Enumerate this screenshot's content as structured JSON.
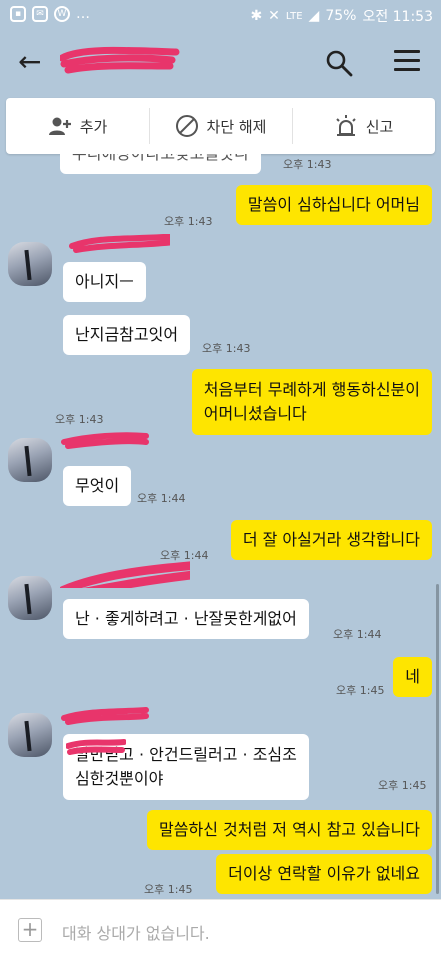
{
  "statusbar": {
    "battery": "75%",
    "time": "오전 11:53",
    "network": "LTE"
  },
  "header": {
    "back_label": "←"
  },
  "actions": [
    {
      "label": "추가"
    },
    {
      "label": "차단 해제"
    },
    {
      "label": "신고"
    }
  ],
  "partial_message": {
    "text": "우리애장아라고갖고놀앗니",
    "time": "오후 1:43"
  },
  "messages": [
    {
      "text": "말씀이 심하십니다 어머님",
      "time": "오후 1:43"
    },
    {
      "text": "아니지ㅡ"
    },
    {
      "text": "난지금참고잇어",
      "time": "오후 1:43"
    },
    {
      "line1": "처음부터 무례하게 행동하신분이",
      "line2": "어머니셨습니다",
      "time": "오후 1:43"
    },
    {
      "text": "무엇이",
      "time": "오후 1:44"
    },
    {
      "text": "더 잘 아실거라 생각합니다",
      "time": "오후 1:44"
    },
    {
      "text": "난 · 좋게하려고 · 난잘못한게없어",
      "time": "오후 1:44"
    },
    {
      "text": "네",
      "time": "오후 1:45"
    },
    {
      "line1": "말만믿고 · 안건드릴러고 · 조심조",
      "line2": "심한것뿐이야",
      "time": "오후 1:45"
    },
    {
      "text": "말씀하신 것처럼 저 역시 참고 있습니다"
    },
    {
      "text": "더이상 연락할 이유가 없네요",
      "time": "오후 1:45"
    }
  ],
  "input": {
    "placeholder": "대화 상대가 없습니다."
  },
  "colors": {
    "background": "#b2c7d9",
    "my_bubble": "#fee500",
    "their_bubble": "#ffffff",
    "redaction": "#e8356b"
  }
}
